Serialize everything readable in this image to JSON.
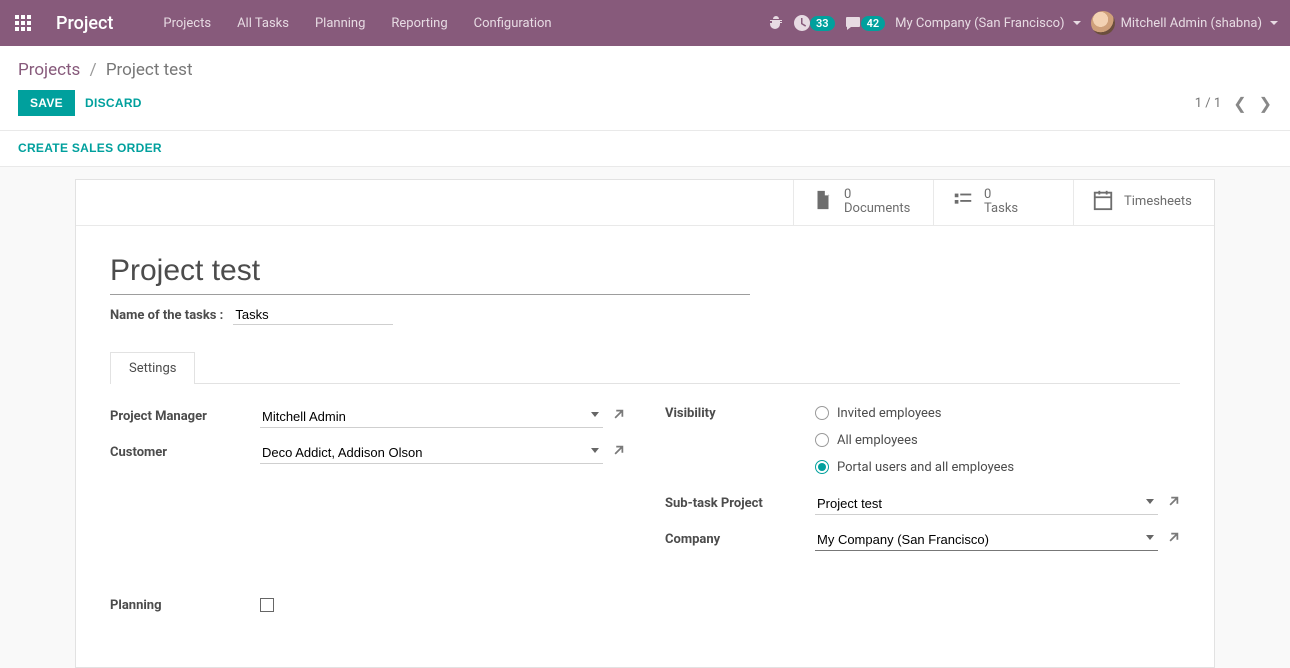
{
  "navbar": {
    "brand": "Project",
    "menu": [
      "Projects",
      "All Tasks",
      "Planning",
      "Reporting",
      "Configuration"
    ],
    "activities_count": "33",
    "messages_count": "42",
    "company": "My Company (San Francisco)",
    "user": "Mitchell Admin (shabna)"
  },
  "breadcrumb": {
    "root": "Projects",
    "current": "Project test"
  },
  "controls": {
    "save": "SAVE",
    "discard": "DISCARD",
    "pager": "1 / 1"
  },
  "action_bar": {
    "create_sales_order": "CREATE SALES ORDER"
  },
  "stat_buttons": {
    "documents": {
      "count": "0",
      "label": "Documents"
    },
    "tasks": {
      "count": "0",
      "label": "Tasks"
    },
    "timesheets": {
      "label": "Timesheets"
    }
  },
  "form": {
    "title": "Project test",
    "name_of_tasks_label": "Name of the tasks :",
    "name_of_tasks_value": "Tasks",
    "tab_settings": "Settings",
    "fields": {
      "project_manager_label": "Project Manager",
      "project_manager_value": "Mitchell Admin",
      "customer_label": "Customer",
      "customer_value": "Deco Addict, Addison Olson",
      "visibility_label": "Visibility",
      "visibility_options": {
        "invited": "Invited employees",
        "all": "All employees",
        "portal": "Portal users and all employees"
      },
      "subtask_project_label": "Sub-task Project",
      "subtask_project_value": "Project test",
      "company_label": "Company",
      "company_value": "My Company (San Francisco)",
      "planning_label": "Planning"
    }
  }
}
